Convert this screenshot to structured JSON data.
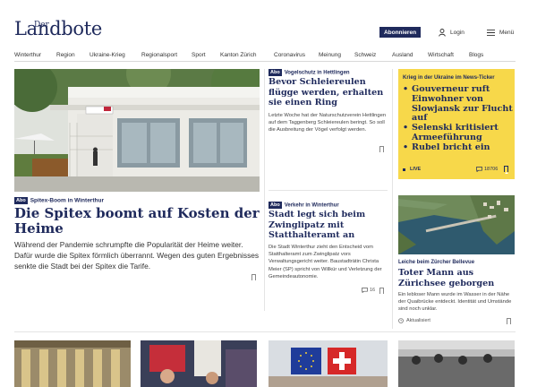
{
  "header": {
    "logo_small": "Der",
    "logo_main": "Landbote",
    "subscribe_label": "Abonnieren",
    "login_label": "Login",
    "menu_label": "Menü"
  },
  "nav": {
    "items": [
      "Winterthur",
      "Region",
      "Ukraine-Krieg",
      "Regionalsport",
      "Sport",
      "Kanton Zürich",
      "Coronavirus",
      "Meinung",
      "Schweiz",
      "Ausland",
      "Wirtschaft",
      "Blogs"
    ]
  },
  "main_story": {
    "badge": "Abo",
    "kicker": "Spitex-Boom in Winterthur",
    "title": "Die Spitex boomt auf Kosten der Heime",
    "lead": "Während der Pandemie schrumpfte die Popularität der Heime weiter. Dafür wurde die Spitex förmlich überrannt. Wegen des guten Ergebnisses senkte die Stadt bei der Spitex die Tarife."
  },
  "story_2": {
    "badge": "Abo",
    "kicker": "Vogelschutz in Hettlingen",
    "title": "Bevor Schleiereulen flügge werden, erhalten sie einen Ring",
    "lead": "Letzte Woche hat der Naturschutzverein Hettlingen auf dem Taggenberg Schleiereulen beringt. So soll die Ausbreitung der Vögel verfolgt werden."
  },
  "story_3": {
    "badge": "Abo",
    "kicker": "Verkehr in Winterthur",
    "title": "Stadt legt sich beim Zwinglipatz mit Statthalteramt an",
    "lead": "Die Stadt Winterthur zieht den Entscheid vom Statthalteramt zum Zwinglipatz vors Verwaltungsgericht weiter. Baustadträtin Christa Meier (SP) spricht von Willkür und Verletzung der Gemeindeautonomie.",
    "comments": "16"
  },
  "ticker": {
    "kicker": "Krieg in der Ukraine im News-Ticker",
    "items": [
      "Gouverneur ruft Einwohner von Slowjansk zur Flucht auf",
      "Selenski kritisiert Armeeführung",
      "Rubel bricht ein"
    ],
    "live_label": "LIVE",
    "comments": "18706"
  },
  "story_4": {
    "kicker": "Leiche beim Zürcher Bellevue",
    "title": "Toter Mann aus Zürichsee geborgen",
    "lead": "Ein lebloser Mann wurde im Wasser in der Nähe der Quaibrücke entdeckt. Identität und Umstände sind noch unklar.",
    "updated": "Aktualisiert"
  },
  "colors": {
    "brand_navy": "#1f2a5c",
    "ticker_yellow": "#f7d84a"
  }
}
